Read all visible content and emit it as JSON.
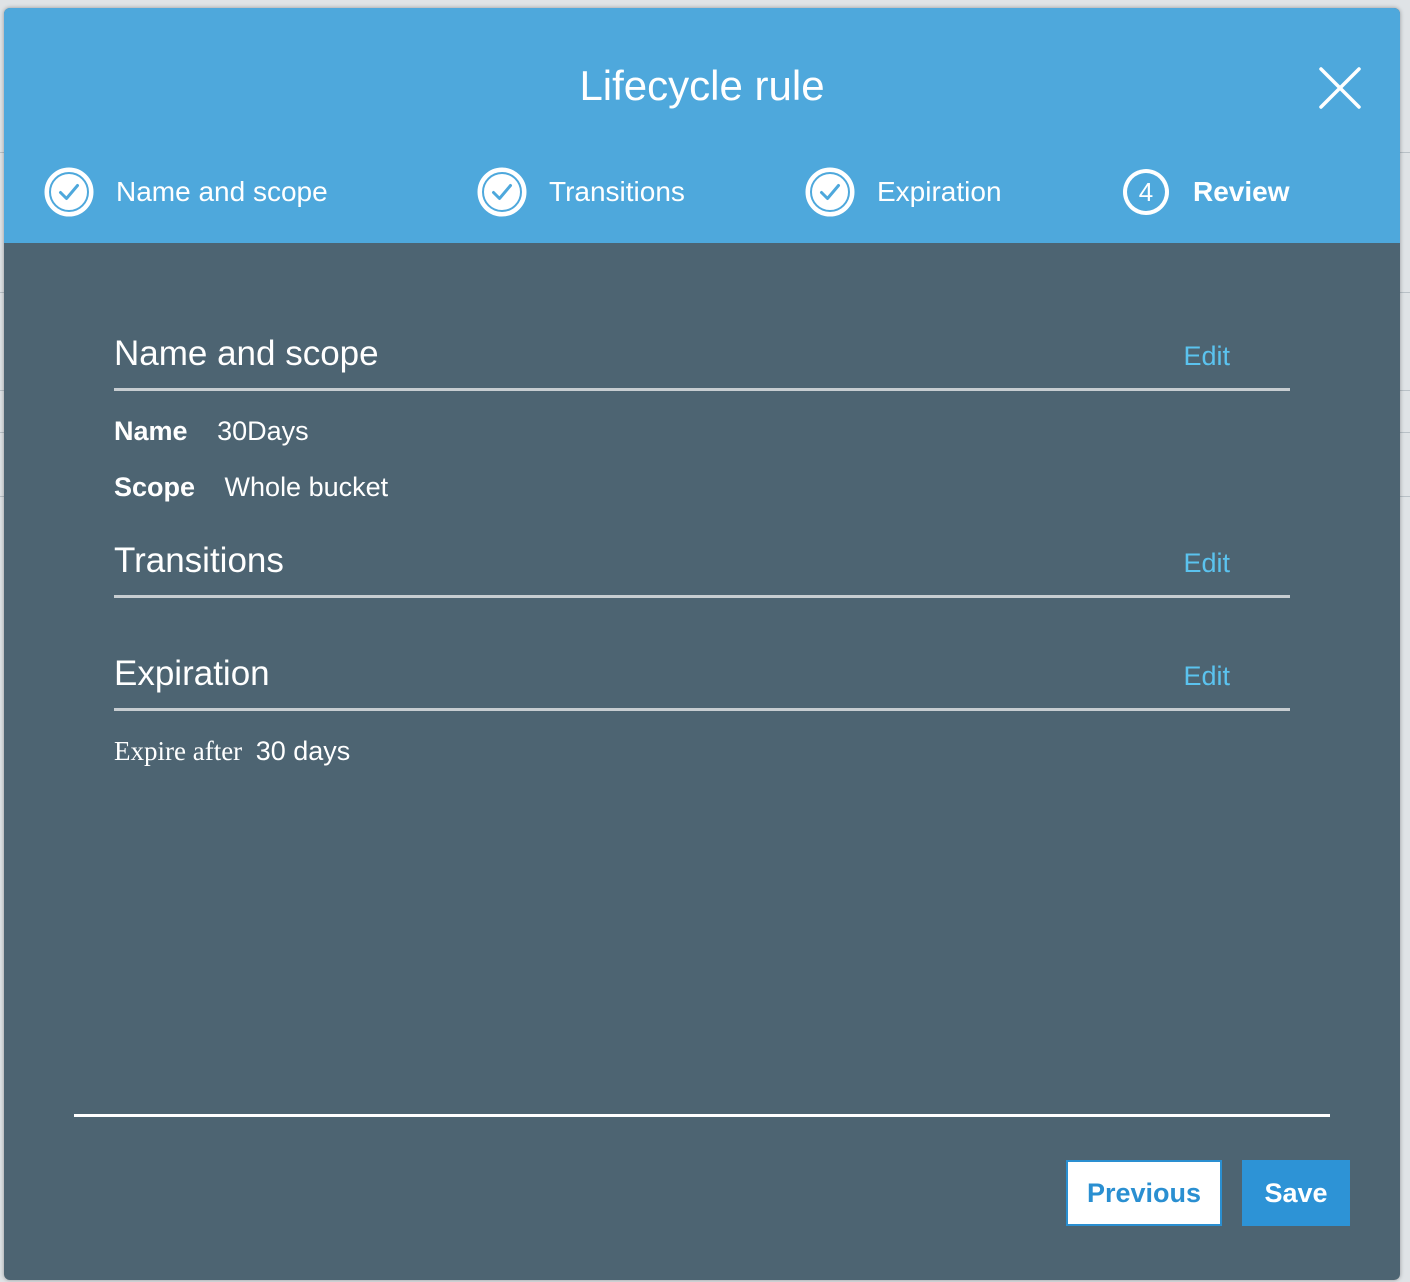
{
  "modal": {
    "title": "Lifecycle rule"
  },
  "steps": [
    {
      "label": "Name and scope",
      "state": "complete",
      "icon": "check-circle-icon"
    },
    {
      "label": "Transitions",
      "state": "complete",
      "icon": "check-circle-icon"
    },
    {
      "label": "Expiration",
      "state": "complete",
      "icon": "check-circle-icon"
    },
    {
      "label": "Review",
      "state": "active",
      "number": "4",
      "icon": "numbered-circle-icon"
    }
  ],
  "review": {
    "name_scope": {
      "title": "Name and scope",
      "edit_label": "Edit",
      "name_key": "Name",
      "name_value": "30Days",
      "scope_key": "Scope",
      "scope_value": "Whole bucket"
    },
    "transitions": {
      "title": "Transitions",
      "edit_label": "Edit"
    },
    "expiration": {
      "title": "Expiration",
      "edit_label": "Edit",
      "expire_prefix": "Expire after",
      "expire_value": "30 days"
    }
  },
  "footer": {
    "previous_label": "Previous",
    "save_label": "Save"
  },
  "colors": {
    "header_bg": "#4ea8dc",
    "body_bg": "#4d6472",
    "link": "#5bc3ef",
    "primary_button": "#2d93d6"
  }
}
